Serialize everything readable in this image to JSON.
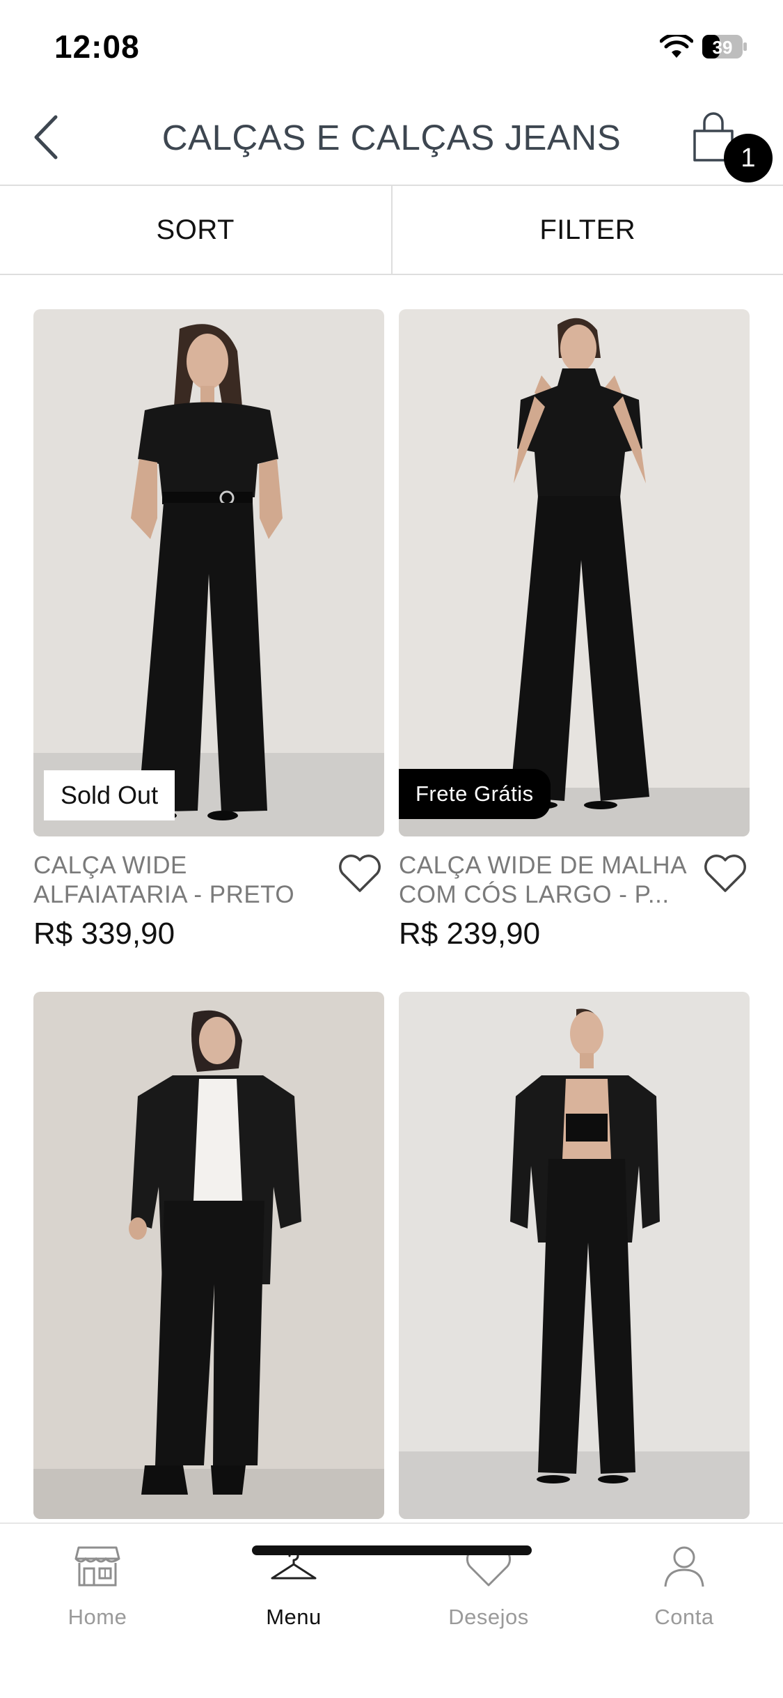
{
  "status": {
    "time": "12:08",
    "battery": "39"
  },
  "header": {
    "title": "CALÇAS E CALÇAS JEANS",
    "cart_count": "1"
  },
  "controls": {
    "sort": "SORT",
    "filter": "FILTER"
  },
  "products": [
    {
      "name_line1": "CALÇA WIDE",
      "name_line2": "ALFAIATARIA - PRETO",
      "price": "R$ 339,90",
      "badge": "Sold Out"
    },
    {
      "name_line1": "CALÇA WIDE DE MALHA",
      "name_line2": "COM CÓS LARGO  - P...",
      "price": "R$ 239,90",
      "badge": "Frete Grátis"
    },
    {
      "name_line1": "",
      "name_line2": "",
      "price": "",
      "badge": ""
    },
    {
      "name_line1": "",
      "name_line2": "",
      "price": "",
      "badge": ""
    }
  ],
  "tabs": [
    {
      "label": "Home",
      "icon": "storefront-icon"
    },
    {
      "label": "Menu",
      "icon": "hanger-icon"
    },
    {
      "label": "Desejos",
      "icon": "heart-icon"
    },
    {
      "label": "Conta",
      "icon": "person-icon"
    }
  ],
  "colors": {
    "accent": "#000000",
    "title": "#3d4650",
    "muted": "#7a7a7a",
    "inactive_tab": "#9a9a9a"
  }
}
